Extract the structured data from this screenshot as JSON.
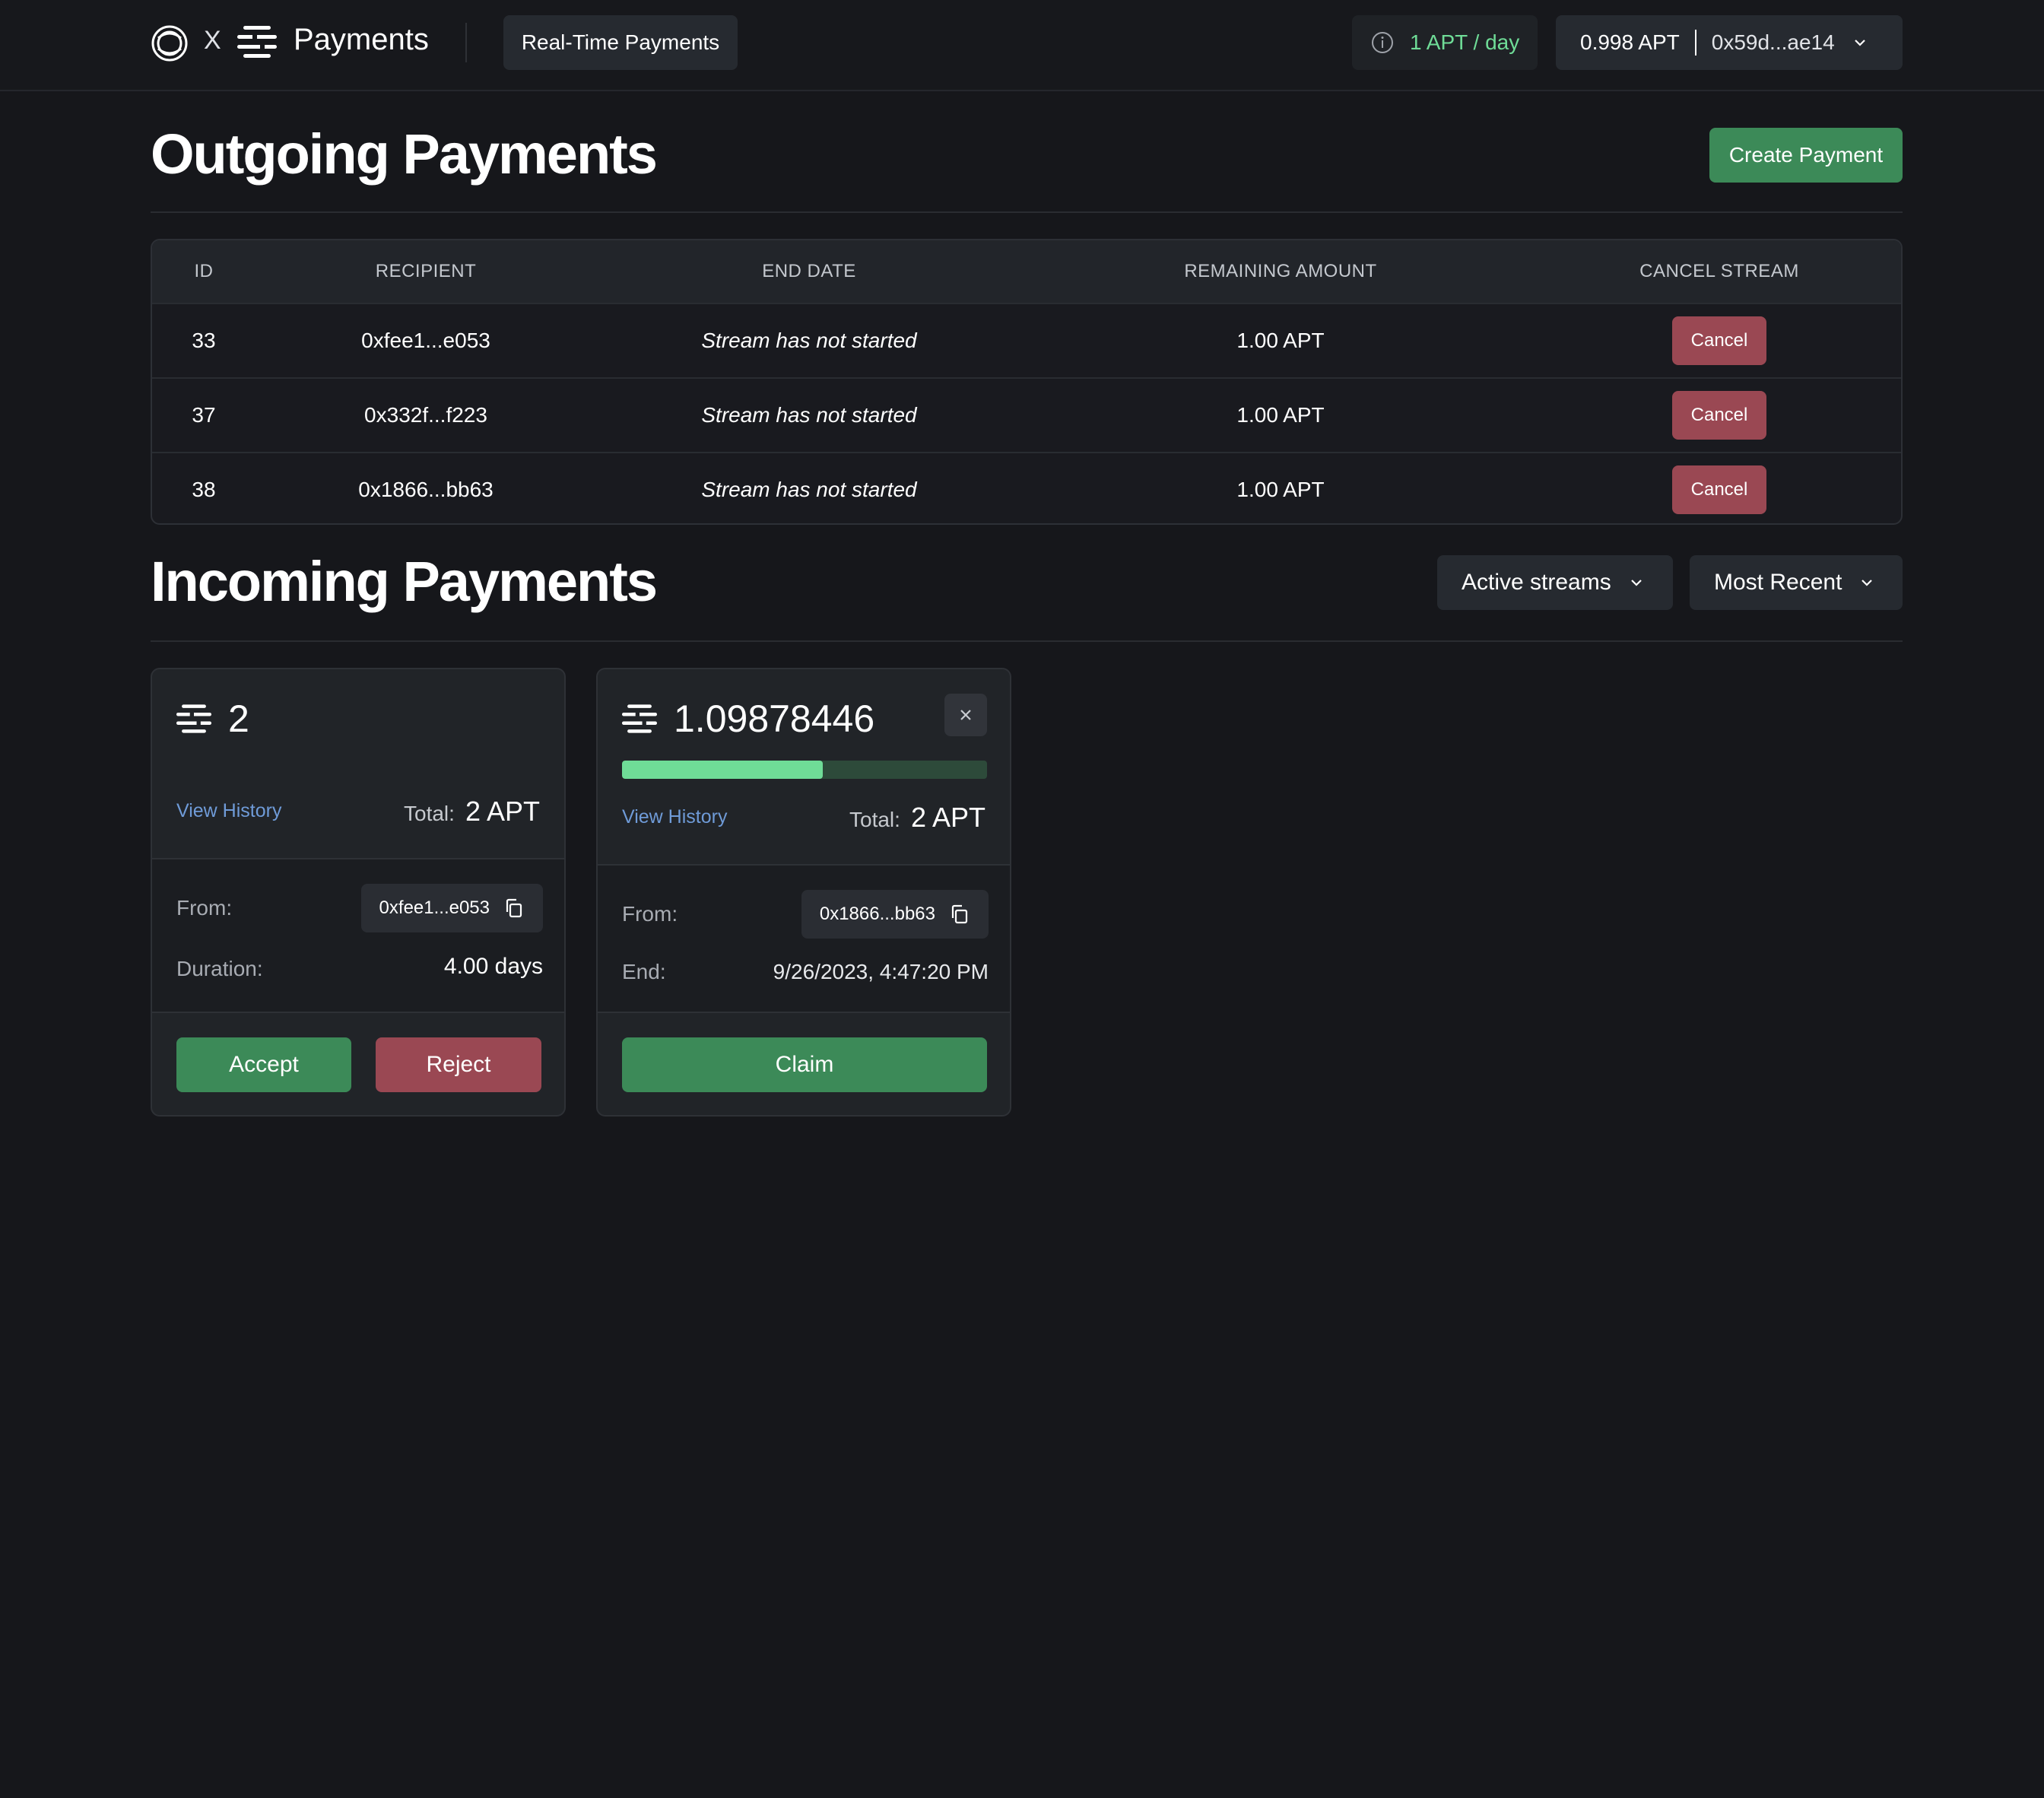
{
  "nav": {
    "brand_x": "X",
    "title": "Payments",
    "tab_label": "Real-Time Payments",
    "rate_text": "1 APT / day",
    "wallet_balance": "0.998 APT",
    "wallet_address": "0x59d...ae14",
    "icons": [
      "petra-logo-icon",
      "aptos-logo-icon",
      "info-icon",
      "chevron-down-icon"
    ]
  },
  "outgoing": {
    "title": "Outgoing Payments",
    "create_button": "Create Payment",
    "columns": [
      "ID",
      "RECIPIENT",
      "END DATE",
      "REMAINING AMOUNT",
      "CANCEL STREAM"
    ],
    "rows": [
      {
        "id": "33",
        "recipient": "0xfee1...e053",
        "end_date": "Stream has not started",
        "remaining": "1.00 APT",
        "action": "Cancel"
      },
      {
        "id": "37",
        "recipient": "0x332f...f223",
        "end_date": "Stream has not started",
        "remaining": "1.00 APT",
        "action": "Cancel"
      },
      {
        "id": "38",
        "recipient": "0x1866...bb63",
        "end_date": "Stream has not started",
        "remaining": "1.00 APT",
        "action": "Cancel"
      }
    ]
  },
  "incoming": {
    "title": "Incoming Payments",
    "filter_status": "Active streams",
    "filter_sort": "Most Recent",
    "cards": [
      {
        "amount": "2",
        "view_history": "View History",
        "total_label": "Total:",
        "total_value": "2 APT",
        "from_label": "From:",
        "from_address": "0xfee1...e053",
        "detail_label": "Duration:",
        "detail_value": "4.00 days",
        "accept_label": "Accept",
        "reject_label": "Reject"
      },
      {
        "amount": "1.09878446",
        "progress": 0.55,
        "view_history": "View History",
        "total_label": "Total:",
        "total_value": "2 APT",
        "from_label": "From:",
        "from_address": "0x1866...bb63",
        "detail_label": "End:",
        "detail_value": "9/26/2023, 4:47:20 PM",
        "claim_label": "Claim"
      }
    ]
  },
  "colors": {
    "background": "#16171b",
    "accent_green": "#3c8a58",
    "danger_red": "#9a4853",
    "progress_green": "#6fdc97",
    "link_blue": "#6f9bd8"
  }
}
